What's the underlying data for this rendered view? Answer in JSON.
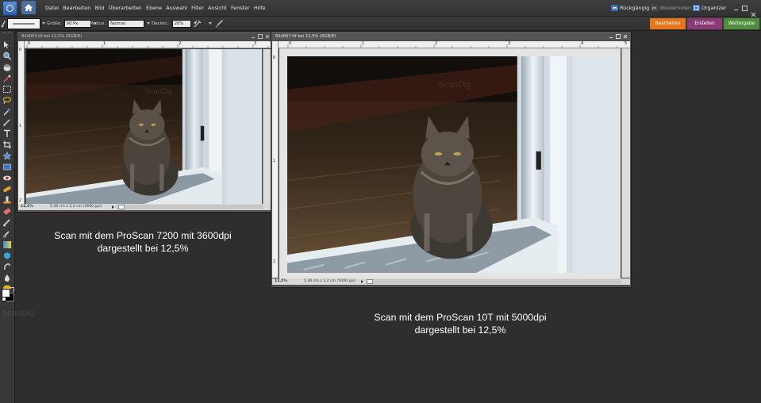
{
  "menu": {
    "items": [
      "Datei",
      "Bearbeiten",
      "Bild",
      "Überarbeiten",
      "Ebene",
      "Auswahl",
      "Filter",
      "Ansicht",
      "Fenster",
      "Hilfe"
    ],
    "undo_label": "Rückgängig",
    "redo_label": "Wiederholen",
    "organizer_label": "Organizer"
  },
  "options_bar": {
    "size_label": "Größe:",
    "size_value": "90 Px",
    "mode_label": "Modus:",
    "mode_value": "Normal",
    "opacity_label": "Deckkr.:",
    "opacity_value": "20%"
  },
  "workspace_tabs": [
    {
      "label": "Bearbeiten",
      "color": "#e8751a"
    },
    {
      "label": "Erstellen",
      "color": "#8a3a74"
    },
    {
      "label": "Weitergabe",
      "color": "#4f8f3c"
    }
  ],
  "documents": {
    "left": {
      "title": "Bild003.tif bei 12,5% (RGB/8)",
      "zoom": "12,5%",
      "info": "5,36 cm x 2,2 cm (3600 ppi)",
      "ruler_h": [
        "0",
        "1",
        "2",
        "3"
      ],
      "ruler_v": [
        "0",
        "1",
        "2"
      ],
      "watermark": "ScanDig"
    },
    "right": {
      "title": "Bild007.tif bei 12,5% (RGB/8)",
      "zoom": "12,5%",
      "info": "5,36 cm x 2,2 cm (5000 ppi)",
      "ruler_h": [
        "0",
        "1",
        "2",
        "3",
        "4",
        "5"
      ],
      "ruler_v": [
        "0",
        "1",
        "2"
      ],
      "watermark": "ScanDig"
    }
  },
  "captions": {
    "left": [
      "Scan mit dem ProScan 7200 mit 3600dpi",
      "dargestellt bei 12,5%"
    ],
    "right": [
      "Scan mit dem ProScan 10T mit 5000dpi",
      "dargestellt bei 12,5%"
    ]
  },
  "watermark_bg": "ScanDig",
  "colors": {
    "accent_orange": "#e8751a",
    "workspace_bg": "#2e2e2e"
  }
}
